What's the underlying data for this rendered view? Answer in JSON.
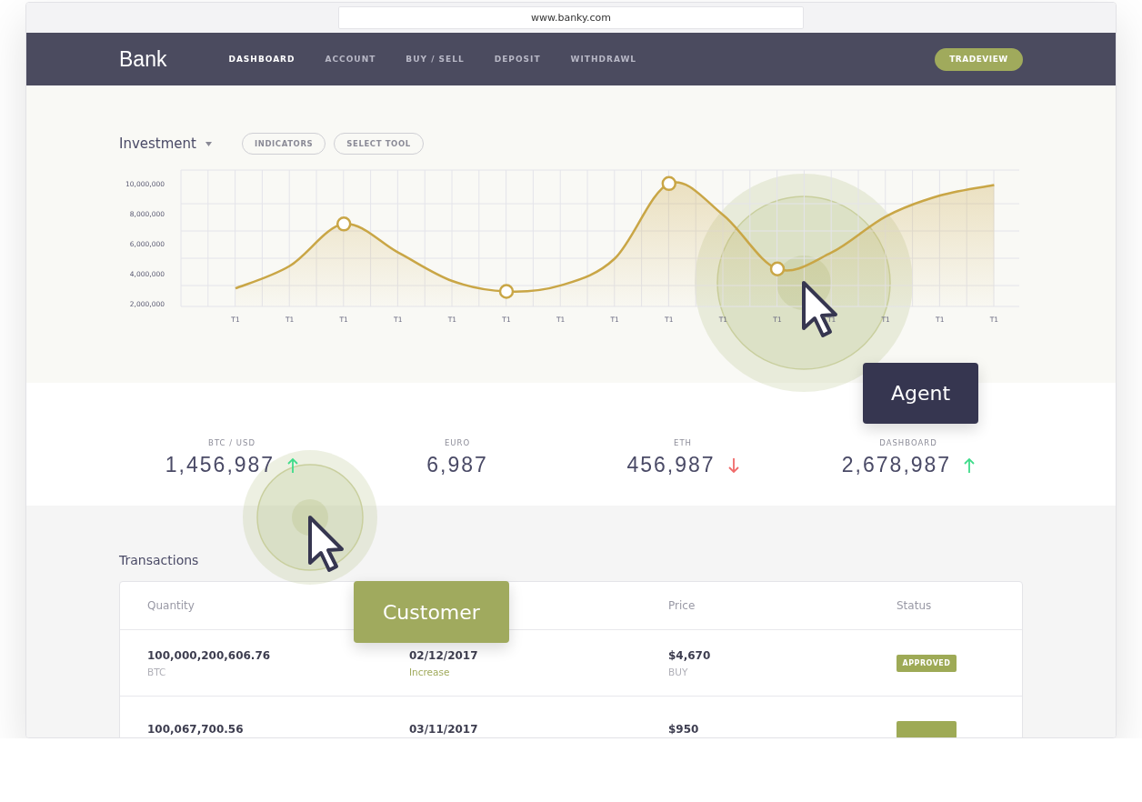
{
  "browser": {
    "url": "www.banky.com"
  },
  "nav": {
    "logo": "Bank",
    "items": [
      {
        "label": "DASHBOARD",
        "selected": true
      },
      {
        "label": "ACCOUNT",
        "selected": false
      },
      {
        "label": "BUY / SELL",
        "selected": false
      },
      {
        "label": "DEPOSIT",
        "selected": false
      },
      {
        "label": "WITHDRAWL",
        "selected": false
      }
    ],
    "action": "TRADEVIEW"
  },
  "investment": {
    "buttons": [
      "INDICATORS",
      "SELECT TOOL"
    ],
    "chart_data": {
      "type": "area",
      "title": "Investment",
      "grid": true,
      "ylim": [
        1800000,
        10900000
      ],
      "categories": [
        "T1",
        "T1",
        "T1",
        "T1",
        "T1",
        "T1",
        "T1",
        "T1",
        "T1",
        "T1",
        "T1",
        "T1",
        "T1",
        "T1",
        "T1"
      ],
      "series": [
        {
          "color": "#c9a646",
          "values": [
            3000000,
            4500000,
            7300000,
            5400000,
            3500000,
            2800000,
            3200000,
            5000000,
            10000000,
            7900000,
            4300000,
            5400000,
            7800000,
            9200000,
            9900000
          ]
        }
      ],
      "yticks": [
        {
          "value": 2000000,
          "label": "2,000,000"
        },
        {
          "value": 4000000,
          "label": "4,000,000"
        },
        {
          "value": 6000000,
          "label": "6,000,000"
        },
        {
          "value": 8000000,
          "label": "8,000,000"
        },
        {
          "value": 10000000,
          "label": "10,000,000"
        }
      ]
    }
  },
  "stats": [
    {
      "kind": "rising",
      "label": "BTC / USD",
      "value": "1,456,987"
    },
    {
      "kind": "flat",
      "label": "EURO",
      "value": "6,987"
    },
    {
      "kind": "falling",
      "label": "ETH",
      "value": "456,987"
    },
    {
      "kind": "rising",
      "label": "DASHBOARD",
      "value": "2,678,987"
    }
  ],
  "transactions": {
    "title": "Transactions",
    "columns": [
      "Quantity",
      "",
      "Price",
      "Status"
    ],
    "rows": [
      {
        "quantity": "100,000,200,606.76",
        "unit": "BTC",
        "date": "02/12/2017",
        "change": "Increase",
        "price": "$4,670",
        "side": "BUY",
        "status": {
          "label": "APPROVED",
          "color": "#9eaa56"
        }
      },
      {
        "quantity": "100,067,700.56",
        "date": "03/11/2017",
        "price": "$950",
        "status": {
          "color": "#9eaa56"
        }
      }
    ]
  },
  "pointers": [
    {
      "kind": "agent",
      "label": "Agent"
    },
    {
      "kind": "customer",
      "label": "Customer"
    }
  ]
}
